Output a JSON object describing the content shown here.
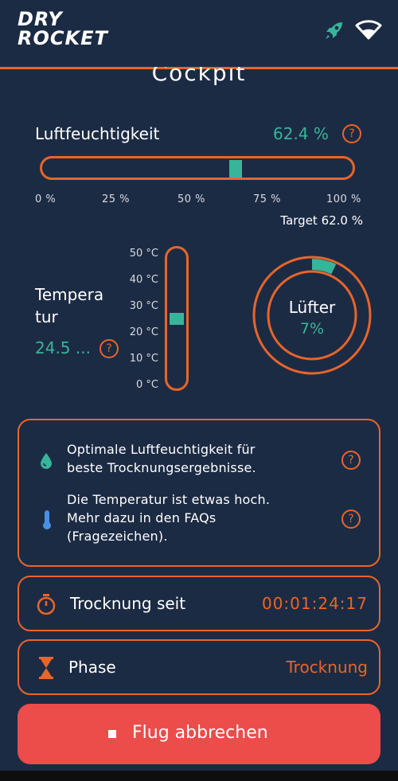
{
  "header": {
    "logo_line1": "DRY",
    "logo_line2": "ROCKET",
    "icons": [
      "rocket-icon",
      "wifi-icon"
    ],
    "accent_color": "#e8652a"
  },
  "page": {
    "title": "Cockpit"
  },
  "humidity": {
    "label": "Luftfeuchtigkeit",
    "value": "62.4 %",
    "value_numeric": 62.4,
    "ticks": [
      "0 %",
      "25 %",
      "50 %",
      "75 %",
      "100 %"
    ],
    "target": "Target 62.0 %",
    "help": "?"
  },
  "temperature": {
    "label_line1": "Tempera",
    "label_line2": "tur",
    "value": "24.5 ...",
    "value_numeric": 24.5,
    "scale": [
      "50 °C",
      "40 °C",
      "30 °C",
      "20 °C",
      "10 °C",
      "0 °C"
    ],
    "help": "?"
  },
  "fan": {
    "label": "Lüfter",
    "value": "7%",
    "value_numeric": 7
  },
  "info": {
    "items": [
      {
        "icon": "water-drop-icon",
        "text_line1": "Optimale Luftfeuchtigkeit für",
        "text_line2": "beste Trocknungsergebnisse.",
        "help": "?"
      },
      {
        "icon": "thermometer-icon",
        "text_line1": "Die Temperatur ist etwas hoch.",
        "text_line2": "Mehr dazu in den FAQs",
        "text_line3": "(Fragezeichen).",
        "help": "?"
      }
    ]
  },
  "drying": {
    "icon": "stopwatch-icon",
    "label": "Trocknung seit",
    "value": "00:01:24:17"
  },
  "phase": {
    "icon": "hourglass-icon",
    "label": "Phase",
    "value": "Trocknung"
  },
  "abort": {
    "icon": "stop-icon",
    "label": "Flug abbrechen",
    "color": "#ec4c4a"
  },
  "colors": {
    "background": "#1c2b44",
    "teal": "#37b59a",
    "orange": "#e8652a"
  }
}
